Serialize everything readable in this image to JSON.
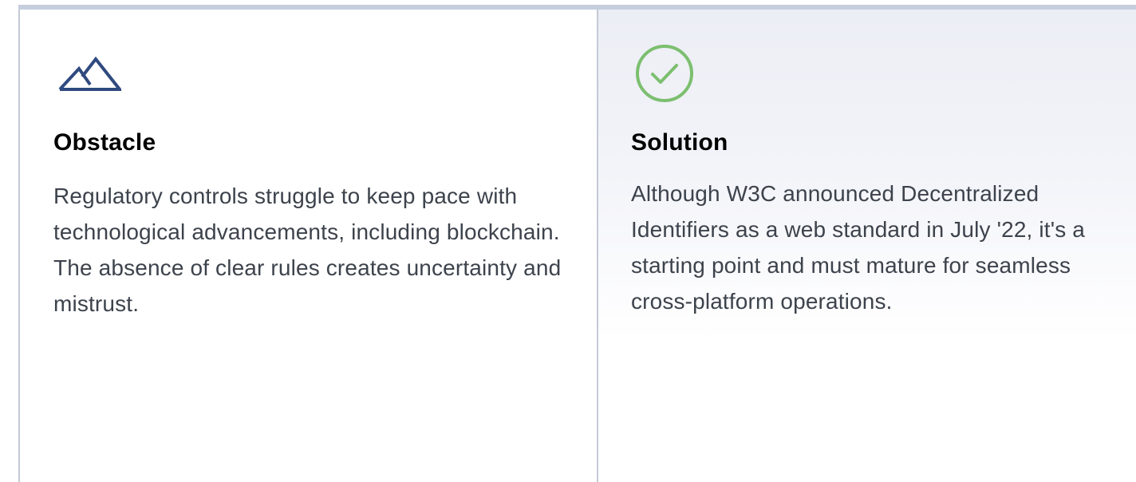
{
  "obstacle": {
    "icon": "mountain-icon",
    "title": "Obstacle",
    "body": "Regulatory controls struggle to keep pace with technological advancements, including blockchain. The absence of clear rules creates uncertainty and mistrust.",
    "icon_color": "#2f4a7f"
  },
  "solution": {
    "icon": "checkmark-circle-icon",
    "title": "Solution",
    "body": "Although W3C announced Decentralized Identifiers as a web standard in July '22, it's a starting point and must mature for seamless cross-platform operations.",
    "icon_color": "#7cbf6f"
  },
  "colors": {
    "top_border": "#c5cedd",
    "divider": "#c3cad6",
    "title_text": "#000000",
    "body_text": "#3d434c"
  }
}
